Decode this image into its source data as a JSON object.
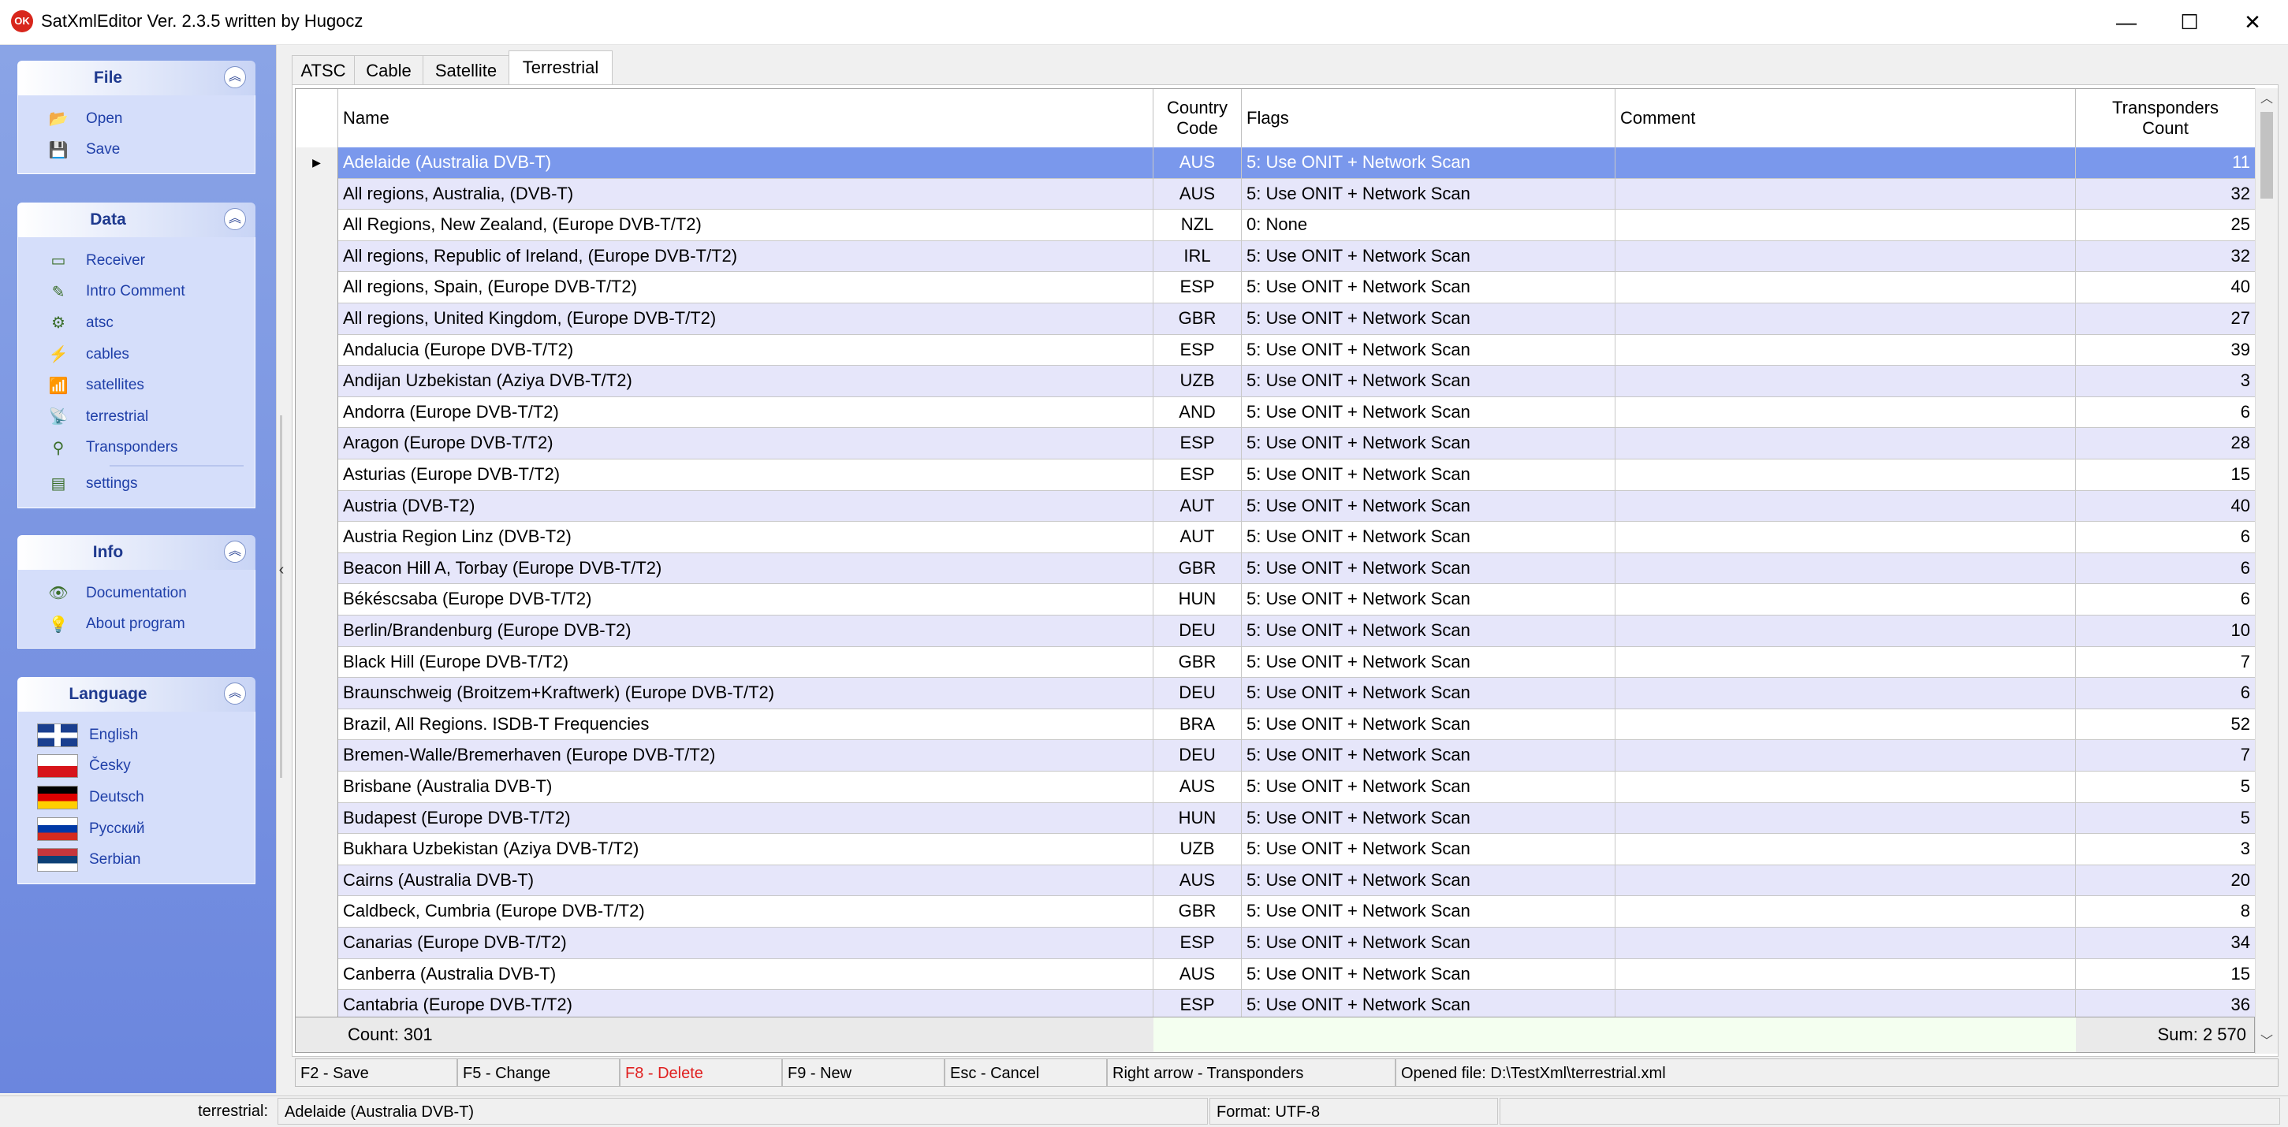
{
  "window": {
    "title": "SatXmlEditor Ver. 2.3.5 written by Hugocz",
    "icon_text": "OK",
    "minimize": "—",
    "maximize": "☐",
    "close": "✕"
  },
  "sidebar": {
    "groups": [
      {
        "title": "File",
        "items": [
          {
            "label": "Open",
            "icon": "open-folder-icon",
            "glyph": "📂"
          },
          {
            "label": "Save",
            "icon": "save-icon",
            "glyph": "💾"
          }
        ]
      },
      {
        "title": "Data",
        "items": [
          {
            "label": "Receiver",
            "icon": "receiver-icon",
            "glyph": "▭"
          },
          {
            "label": "Intro Comment",
            "icon": "comment-icon",
            "glyph": "✎"
          },
          {
            "label": "atsc",
            "icon": "atsc-icon",
            "glyph": "⚙"
          },
          {
            "label": "cables",
            "icon": "cables-icon",
            "glyph": "⚡"
          },
          {
            "label": "satellites",
            "icon": "satellite-icon",
            "glyph": "📶"
          },
          {
            "label": "terrestrial",
            "icon": "antenna-icon",
            "glyph": "📡"
          },
          {
            "label": "Transponders",
            "icon": "transponders-icon",
            "glyph": "⚲"
          },
          {
            "label": "settings",
            "icon": "settings-icon",
            "glyph": "▤"
          }
        ]
      },
      {
        "title": "Info",
        "items": [
          {
            "label": "Documentation",
            "icon": "eye-icon",
            "glyph": "👁"
          },
          {
            "label": "About program",
            "icon": "lightbulb-icon",
            "glyph": "💡"
          }
        ]
      },
      {
        "title": "Language",
        "items": [
          {
            "label": "English",
            "icon": "uk-flag-icon"
          },
          {
            "label": "Česky",
            "icon": "czech-flag-icon"
          },
          {
            "label": "Deutsch",
            "icon": "german-flag-icon"
          },
          {
            "label": "Русский",
            "icon": "russian-flag-icon"
          },
          {
            "label": "Serbian",
            "icon": "serbian-flag-icon"
          }
        ]
      }
    ],
    "collapse_glyph": "︽"
  },
  "tabs": [
    {
      "label": "ATSC"
    },
    {
      "label": "Cable"
    },
    {
      "label": "Satellite"
    },
    {
      "label": "Terrestrial"
    }
  ],
  "active_tab": "Terrestrial",
  "grid": {
    "headers": {
      "name": "Name",
      "country_line1": "Country",
      "country_line2": "Code",
      "flags": "Flags",
      "comment": "Comment",
      "count_line1": "Transponders",
      "count_line2": "Count"
    },
    "current_row_marker": "▶",
    "rows": [
      {
        "name": "Adelaide (Australia DVB-T)",
        "code": "AUS",
        "flags": "5: Use ONIT + Network Scan",
        "comment": "",
        "count": "11"
      },
      {
        "name": "All regions, Australia, (DVB-T)",
        "code": "AUS",
        "flags": "5: Use ONIT + Network Scan",
        "comment": "",
        "count": "32"
      },
      {
        "name": "All Regions, New Zealand, (Europe DVB-T/T2)",
        "code": "NZL",
        "flags": "0: None",
        "comment": "",
        "count": "25"
      },
      {
        "name": "All regions, Republic of Ireland, (Europe DVB-T/T2)",
        "code": "IRL",
        "flags": "5: Use ONIT + Network Scan",
        "comment": "",
        "count": "32"
      },
      {
        "name": "All regions, Spain, (Europe DVB-T/T2)",
        "code": "ESP",
        "flags": "5: Use ONIT + Network Scan",
        "comment": "",
        "count": "40"
      },
      {
        "name": "All regions, United Kingdom, (Europe DVB-T/T2)",
        "code": "GBR",
        "flags": "5: Use ONIT + Network Scan",
        "comment": "",
        "count": "27"
      },
      {
        "name": "Andalucia (Europe DVB-T/T2)",
        "code": "ESP",
        "flags": "5: Use ONIT + Network Scan",
        "comment": "",
        "count": "39"
      },
      {
        "name": "Andijan Uzbekistan (Aziya DVB-T/T2)",
        "code": "UZB",
        "flags": "5: Use ONIT + Network Scan",
        "comment": "",
        "count": "3"
      },
      {
        "name": "Andorra  (Europe DVB-T/T2)",
        "code": "AND",
        "flags": "5: Use ONIT + Network Scan",
        "comment": "",
        "count": "6"
      },
      {
        "name": "Aragon (Europe DVB-T/T2)",
        "code": "ESP",
        "flags": "5: Use ONIT + Network Scan",
        "comment": "",
        "count": "28"
      },
      {
        "name": "Asturias (Europe DVB-T/T2)",
        "code": "ESP",
        "flags": "5: Use ONIT + Network Scan",
        "comment": "",
        "count": "15"
      },
      {
        "name": "Austria (DVB-T2)",
        "code": "AUT",
        "flags": "5: Use ONIT + Network Scan",
        "comment": "",
        "count": "40"
      },
      {
        "name": "Austria Region Linz (DVB-T2)",
        "code": "AUT",
        "flags": "5: Use ONIT + Network Scan",
        "comment": "",
        "count": "6"
      },
      {
        "name": "Beacon Hill A, Torbay (Europe DVB-T/T2)",
        "code": "GBR",
        "flags": "5: Use ONIT + Network Scan",
        "comment": "",
        "count": "6"
      },
      {
        "name": "Békéscsaba  (Europe DVB-T/T2)",
        "code": "HUN",
        "flags": "5: Use ONIT + Network Scan",
        "comment": "",
        "count": "6"
      },
      {
        "name": "Berlin/Brandenburg (Europe DVB-T2)",
        "code": "DEU",
        "flags": "5: Use ONIT + Network Scan",
        "comment": "",
        "count": "10"
      },
      {
        "name": "Black Hill (Europe DVB-T/T2)",
        "code": "GBR",
        "flags": "5: Use ONIT + Network Scan",
        "comment": "",
        "count": "7"
      },
      {
        "name": "Braunschweig (Broitzem+Kraftwerk) (Europe DVB-T/T2)",
        "code": "DEU",
        "flags": "5: Use ONIT + Network Scan",
        "comment": "",
        "count": "6"
      },
      {
        "name": "Brazil, All Regions. ISDB-T Frequencies",
        "code": "BRA",
        "flags": "5: Use ONIT + Network Scan",
        "comment": "",
        "count": "52"
      },
      {
        "name": "Bremen-Walle/Bremerhaven (Europe DVB-T/T2)",
        "code": "DEU",
        "flags": "5: Use ONIT + Network Scan",
        "comment": "",
        "count": "7"
      },
      {
        "name": "Brisbane (Australia DVB-T)",
        "code": "AUS",
        "flags": "5: Use ONIT + Network Scan",
        "comment": "",
        "count": "5"
      },
      {
        "name": "Budapest  (Europe DVB-T/T2)",
        "code": "HUN",
        "flags": "5: Use ONIT + Network Scan",
        "comment": "",
        "count": "5"
      },
      {
        "name": "Bukhara Uzbekistan (Aziya DVB-T/T2)",
        "code": "UZB",
        "flags": "5: Use ONIT + Network Scan",
        "comment": "",
        "count": "3"
      },
      {
        "name": "Cairns (Australia DVB-T)",
        "code": "AUS",
        "flags": "5: Use ONIT + Network Scan",
        "comment": "",
        "count": "20"
      },
      {
        "name": "Caldbeck, Cumbria (Europe DVB-T/T2)",
        "code": "GBR",
        "flags": "5: Use ONIT + Network Scan",
        "comment": "",
        "count": "8"
      },
      {
        "name": "Canarias (Europe DVB-T/T2)",
        "code": "ESP",
        "flags": "5: Use ONIT + Network Scan",
        "comment": "",
        "count": "34"
      },
      {
        "name": "Canberra (Australia DVB-T)",
        "code": "AUS",
        "flags": "5: Use ONIT + Network Scan",
        "comment": "",
        "count": "15"
      },
      {
        "name": "Cantabria (Europe DVB-T/T2)",
        "code": "ESP",
        "flags": "5: Use ONIT + Network Scan",
        "comment": "",
        "count": "36"
      }
    ],
    "footer": {
      "count": "Count:    301",
      "sum": "Sum:  2 570"
    }
  },
  "scrollbar": {
    "up": "︿",
    "down": "﹀"
  },
  "shortcuts": [
    {
      "label": "F2 - Save",
      "color": "#000000"
    },
    {
      "label": "F5 - Change",
      "color": "#000000"
    },
    {
      "label": "F8 - Delete",
      "color": "#e02020"
    },
    {
      "label": "F9 - New",
      "color": "#000000"
    },
    {
      "label": "Esc - Cancel",
      "color": "#000000"
    },
    {
      "label": "Right arrow - Transponders",
      "color": "#000000"
    },
    {
      "label": "Opened file: D:\\TestXml\\terrestrial.xml",
      "color": "#000000"
    }
  ],
  "statusbar": {
    "context": "terrestrial:",
    "current": "Adelaide (Australia DVB-T)",
    "format": "Format: UTF-8"
  },
  "splitter_arrow": "‹"
}
